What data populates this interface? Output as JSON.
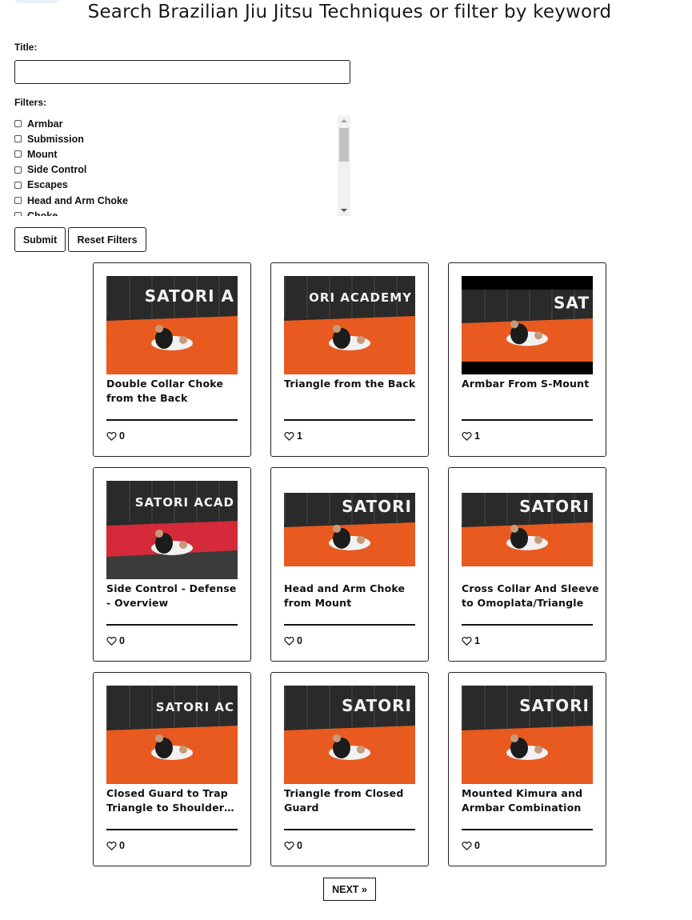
{
  "page": {
    "title": "Search Brazilian Jiu Jitsu Techniques or filter by keyword"
  },
  "search": {
    "title_label": "Title:",
    "title_value": "",
    "title_placeholder": ""
  },
  "filters": {
    "label": "Filters:",
    "items": [
      {
        "label": "Armbar",
        "checked": false
      },
      {
        "label": "Submission",
        "checked": false
      },
      {
        "label": "Mount",
        "checked": false
      },
      {
        "label": "Side Control",
        "checked": false
      },
      {
        "label": "Escapes",
        "checked": false
      },
      {
        "label": "Head and Arm Choke",
        "checked": false
      },
      {
        "label": "Choke",
        "checked": false
      }
    ]
  },
  "buttons": {
    "submit": "Submit",
    "reset": "Reset Filters",
    "next": "NEXT »"
  },
  "colors": {
    "mat_orange": "#e85a1f",
    "mat_red": "#d42a3a",
    "wall_dark": "#2a2a2a",
    "border": "#222222"
  },
  "techniques": [
    {
      "title": "Double Collar Choke from the Back",
      "likes": "0",
      "scene": "orange",
      "wall_text": "SATORI A"
    },
    {
      "title": "Triangle from the Back",
      "likes": "1",
      "scene": "orange",
      "wall_text": "ORI ACADEMY"
    },
    {
      "title": "Armbar From S-Mount",
      "likes": "1",
      "scene": "orange-tall",
      "wall_text": "SAT"
    },
    {
      "title": "Side Control - Defense - Overview",
      "likes": "0",
      "scene": "red",
      "wall_text": "SATORI ACAD"
    },
    {
      "title": "Head and Arm Choke from Mount",
      "likes": "0",
      "scene": "orange-wide",
      "wall_text": "SATORI"
    },
    {
      "title": "Cross Collar And Sleeve to Omoplata/Triangle",
      "likes": "1",
      "scene": "orange-wide",
      "wall_text": "SATORI"
    },
    {
      "title": "Closed Guard to Trap Triangle to Shoulder…",
      "likes": "0",
      "scene": "orange",
      "wall_text": "SATORI AC"
    },
    {
      "title": "Triangle from Closed Guard",
      "likes": "0",
      "scene": "orange",
      "wall_text": "SATORI"
    },
    {
      "title": "Mounted Kimura and Armbar Combination",
      "likes": "0",
      "scene": "orange",
      "wall_text": "SATORI"
    }
  ]
}
